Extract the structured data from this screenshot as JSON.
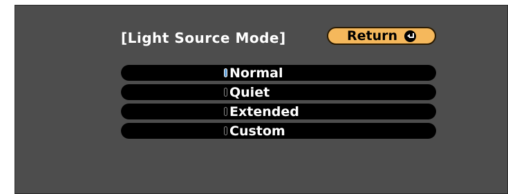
{
  "dialog": {
    "title": "[Light Source Mode]",
    "return_label": "Return"
  },
  "options": [
    {
      "label": "Normal",
      "selected": true
    },
    {
      "label": "Quiet",
      "selected": false
    },
    {
      "label": "Extended",
      "selected": false
    },
    {
      "label": "Custom",
      "selected": false
    }
  ],
  "colors": {
    "background": "#4d4d4d",
    "return_button": "#f5b85c",
    "option_bar": "#000000",
    "text": "#ffffff",
    "selected_radio": "#5b9bd5"
  },
  "icons": {
    "return": "enter-return-icon"
  }
}
